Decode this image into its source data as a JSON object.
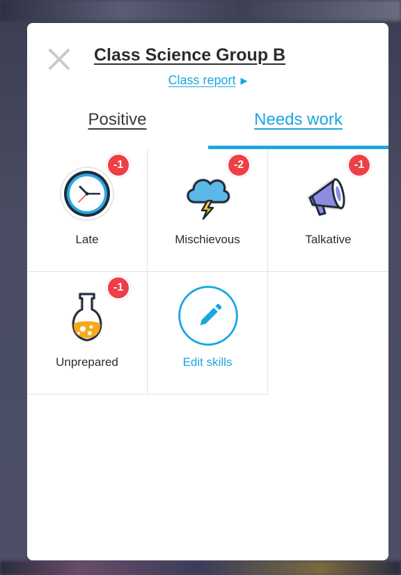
{
  "header": {
    "title": "Class Science Group B",
    "report_label": "Class report",
    "report_arrow": "▶"
  },
  "tabs": [
    {
      "label": "Positive",
      "active": false
    },
    {
      "label": "Needs work",
      "active": true
    }
  ],
  "skills": [
    {
      "label": "Late",
      "badge": "-1",
      "icon": "clock-icon"
    },
    {
      "label": "Mischievous",
      "badge": "-2",
      "icon": "storm-cloud-icon"
    },
    {
      "label": "Talkative",
      "badge": "-1",
      "icon": "megaphone-icon"
    },
    {
      "label": "Unprepared",
      "badge": "-1",
      "icon": "potion-flask-icon"
    }
  ],
  "edit_skills": {
    "label": "Edit skills",
    "icon": "pencil-icon"
  },
  "colors": {
    "accent": "#1aa7e0",
    "badge": "#ee3f46",
    "text": "#2c2a30"
  }
}
